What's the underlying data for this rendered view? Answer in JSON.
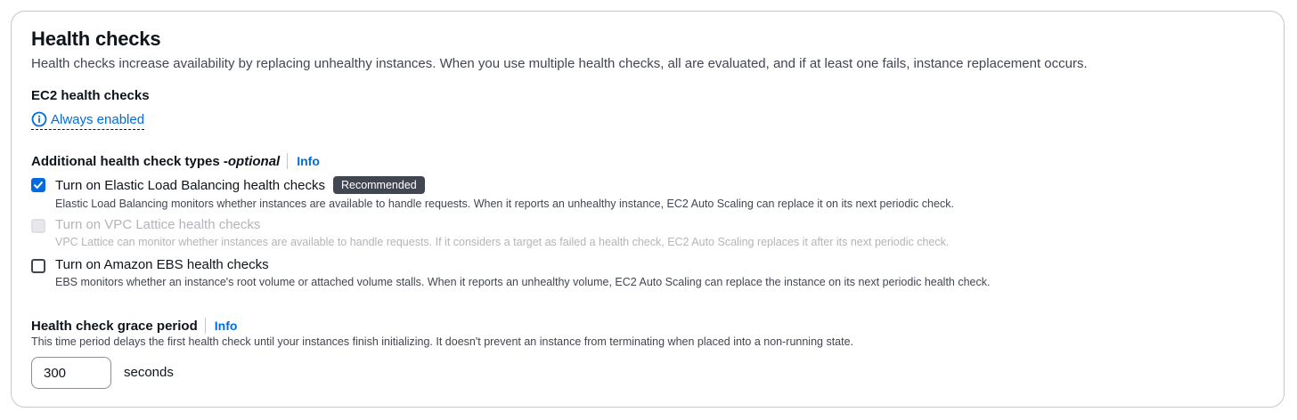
{
  "section": {
    "title": "Health checks",
    "description": "Health checks increase availability by replacing unhealthy instances. When you use multiple health checks, all are evaluated, and if at least one fails, instance replacement occurs."
  },
  "ec2": {
    "label": "EC2 health checks",
    "status_link": "Always enabled",
    "status_icon": "info-circle-icon"
  },
  "additional": {
    "label": "Additional health check types - ",
    "optional": "optional",
    "info_link": "Info",
    "options": [
      {
        "label": "Turn on Elastic Load Balancing health checks",
        "badge": "Recommended",
        "description": "Elastic Load Balancing monitors whether instances are available to handle requests. When it reports an unhealthy instance, EC2 Auto Scaling can replace it on its next periodic check.",
        "checked": true,
        "disabled": false
      },
      {
        "label": "Turn on VPC Lattice health checks",
        "description": "VPC Lattice can monitor whether instances are available to handle requests. If it considers a target as failed a health check, EC2 Auto Scaling replaces it after its next periodic check.",
        "checked": false,
        "disabled": true
      },
      {
        "label": "Turn on Amazon EBS health checks",
        "description": "EBS monitors whether an instance's root volume or attached volume stalls. When it reports an unhealthy volume, EC2 Auto Scaling can replace the instance on its next periodic health check.",
        "checked": false,
        "disabled": false
      }
    ]
  },
  "grace": {
    "label": "Health check grace period",
    "info_link": "Info",
    "description": "This time period delays the first health check until your instances finish initializing. It doesn't prevent an instance from terminating when placed into a non-running state.",
    "value": "300",
    "unit": "seconds"
  },
  "colors": {
    "link": "#006ce0",
    "badge_bg": "#424650",
    "border": "#c6c6cd"
  }
}
